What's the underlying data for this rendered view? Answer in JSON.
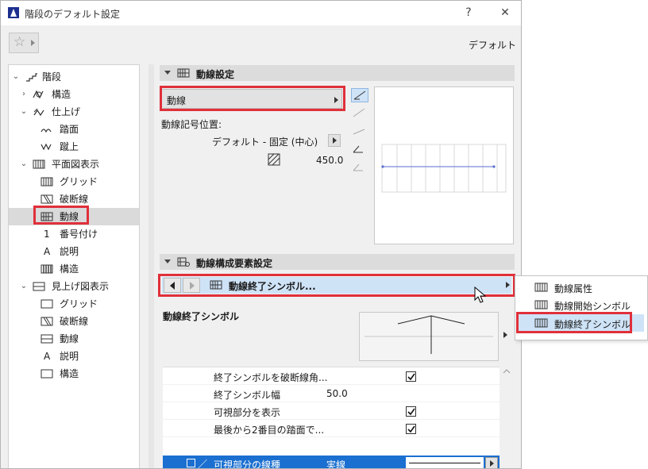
{
  "window": {
    "title": "階段のデフォルト設定",
    "help_glyph": "?",
    "close_glyph": "✕"
  },
  "header": {
    "favorites_icon": "star-icon",
    "default_label": "デフォルト"
  },
  "tree": {
    "items": [
      {
        "label": "階段",
        "icon": "stair-icon",
        "chevron": "expanded"
      },
      {
        "label": "構造",
        "icon": "structure-icon",
        "chevron": "collapsed"
      },
      {
        "label": "仕上げ",
        "icon": "finish-icon",
        "chevron": "expanded"
      },
      {
        "label": "踏面",
        "icon": "tread-icon"
      },
      {
        "label": "蹴上",
        "icon": "riser-icon"
      },
      {
        "label": "平面図表示",
        "icon": "floor-plan-icon",
        "chevron": "expanded"
      },
      {
        "label": "グリッド",
        "icon": "grid-icon"
      },
      {
        "label": "破断線",
        "icon": "break-line-icon"
      },
      {
        "label": "動線",
        "icon": "walking-line-icon",
        "selected": true
      },
      {
        "label": "番号付け",
        "icon": "numbering-icon",
        "glyph": "1"
      },
      {
        "label": "説明",
        "icon": "description-icon",
        "glyph": "A"
      },
      {
        "label": "構造",
        "icon": "structure-plan-icon"
      },
      {
        "label": "見上げ図表示",
        "icon": "reflected-ceiling-icon",
        "chevron": "expanded"
      },
      {
        "label": "グリッド",
        "icon": "grid-icon"
      },
      {
        "label": "破断線",
        "icon": "break-line-icon"
      },
      {
        "label": "動線",
        "icon": "walking-line-icon"
      },
      {
        "label": "説明",
        "icon": "description-icon",
        "glyph": "A"
      },
      {
        "label": "構造",
        "icon": "structure-plan-icon"
      }
    ]
  },
  "walking_line_panel": {
    "title": "動線設定",
    "dropdown_label": "動線",
    "symbol_position_label": "動線記号位置:",
    "symbol_position_value": "デフォルト - 固定 (中心)",
    "offset_value": "450.0"
  },
  "components_panel": {
    "title": "動線構成要素設定",
    "selector_label": "動線終了シンボル...",
    "section_title": "動線終了シンボル"
  },
  "properties": {
    "rows": [
      {
        "label": "終了シンボルを破断線角...",
        "value": "",
        "checked": true
      },
      {
        "label": "終了シンボル幅",
        "value": "50.0",
        "checked": null
      },
      {
        "label": "可視部分を表示",
        "value": "",
        "checked": true
      },
      {
        "label": "最後から2番目の踏面で...",
        "value": "",
        "checked": true
      }
    ],
    "line_row": {
      "label": "可視部分の線種",
      "value": "実線"
    }
  },
  "popup_menu": {
    "items": [
      {
        "label": "動線属性"
      },
      {
        "label": "動線開始シンボル"
      },
      {
        "label": "動線終了シンボル",
        "highlighted": true
      }
    ]
  },
  "colors": {
    "highlight_red": "#e0303a",
    "selection_blue": "#1a6fd0",
    "menu_highlight": "#cfe3f7"
  }
}
